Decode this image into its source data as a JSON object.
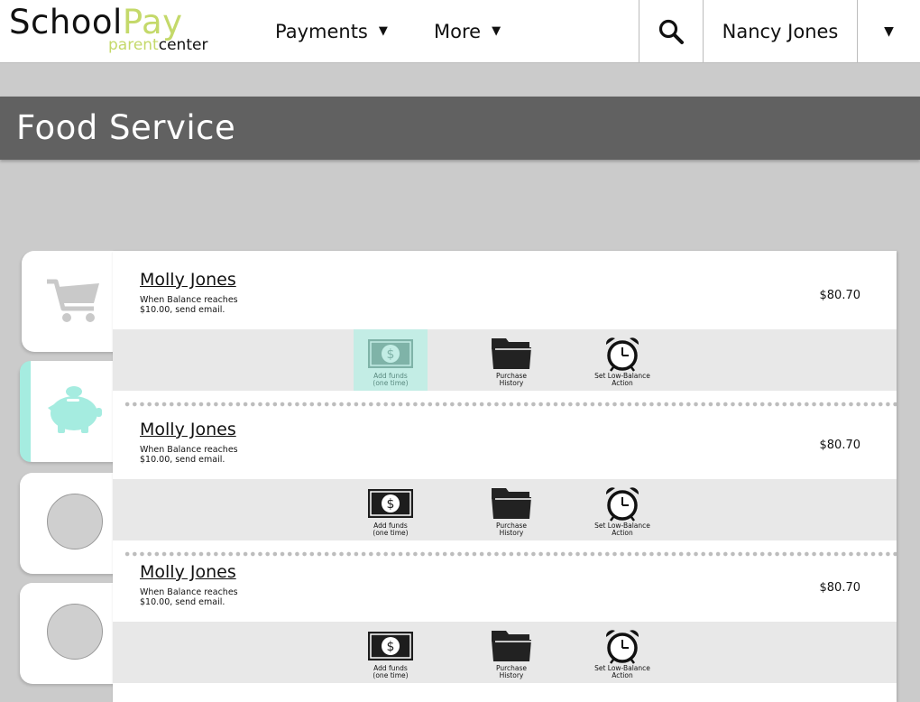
{
  "header": {
    "logo": {
      "word_main": "School",
      "word_accent": "Pay",
      "sub_accent": "parent",
      "sub_main": "center"
    },
    "nav": [
      {
        "label": "Payments"
      },
      {
        "label": "More"
      }
    ],
    "user_name": "Nancy Jones",
    "search_icon": "search-icon",
    "caret_icon": "chevron-down-icon"
  },
  "page": {
    "title": "Food Service"
  },
  "sidebar": {
    "tabs": [
      {
        "icon": "shopping-cart-icon",
        "active": false
      },
      {
        "icon": "piggy-bank-icon",
        "active": true,
        "accent": "#a5ece0"
      },
      {
        "icon": "circle-placeholder",
        "active": false
      },
      {
        "icon": "circle-placeholder",
        "active": false
      }
    ]
  },
  "colors": {
    "accent": "#c4d96a",
    "highlight": "#c3ede5",
    "title_bar": "#616161",
    "background": "#cbcbcb"
  },
  "students": [
    {
      "name": "Molly Jones",
      "alert_text": "When Balance reaches $10.00, send email.",
      "balance": "$80.70",
      "actions": [
        {
          "label_line1": "Add funds",
          "label_line2": "(one time)",
          "icon": "dollar-bill-icon",
          "highlighted": true
        },
        {
          "label_line1": "Purchase",
          "label_line2": "History",
          "icon": "folder-icon"
        },
        {
          "label_line1": "Set Low-Balance",
          "label_line2": "Action",
          "icon": "alarm-clock-icon"
        }
      ]
    },
    {
      "name": "Molly Jones",
      "alert_text": "When Balance reaches $10.00, send email.",
      "balance": "$80.70",
      "actions": [
        {
          "label_line1": "Add funds",
          "label_line2": "(one time)",
          "icon": "dollar-bill-icon",
          "highlighted": false
        },
        {
          "label_line1": "Purchase",
          "label_line2": "History",
          "icon": "folder-icon"
        },
        {
          "label_line1": "Set Low-Balance",
          "label_line2": "Action",
          "icon": "alarm-clock-icon"
        }
      ]
    },
    {
      "name": "Molly Jones",
      "alert_text": "When Balance reaches $10.00, send email.",
      "balance": "$80.70",
      "actions": [
        {
          "label_line1": "Add funds",
          "label_line2": "(one time)",
          "icon": "dollar-bill-icon",
          "highlighted": false
        },
        {
          "label_line1": "Purchase",
          "label_line2": "History",
          "icon": "folder-icon"
        },
        {
          "label_line1": "Set Low-Balance",
          "label_line2": "Action",
          "icon": "alarm-clock-icon"
        }
      ]
    }
  ]
}
